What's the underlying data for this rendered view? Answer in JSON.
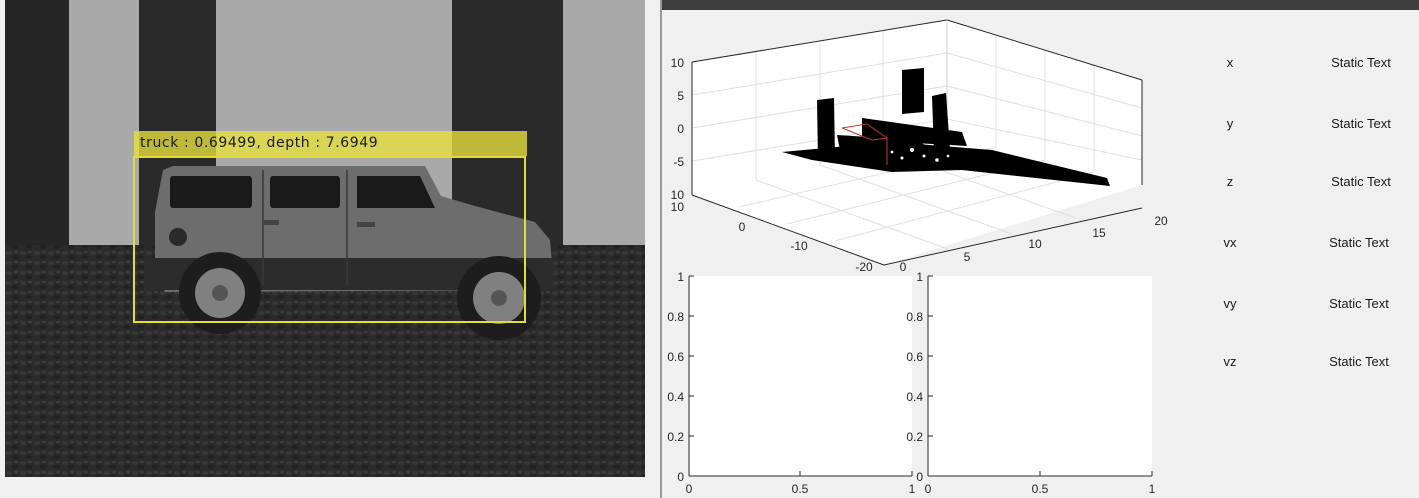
{
  "camera": {
    "detection_label": "truck : 0.69499, depth : 7.6949"
  },
  "plot3d": {
    "z_ticks": [
      "10",
      "5",
      "0",
      "-5",
      "10"
    ],
    "y_ticks": [
      "10",
      "0",
      "-10",
      "-20"
    ],
    "x_ticks": [
      "0",
      "5",
      "10",
      "15",
      "20"
    ]
  },
  "axes_left": {
    "y_ticks": [
      "1",
      "0.8",
      "0.6",
      "0.4",
      "0.2",
      "0"
    ],
    "x_ticks": [
      "0",
      "0.5",
      "1"
    ]
  },
  "axes_right": {
    "y_ticks": [
      "1",
      "0.8",
      "0.6",
      "0.4",
      "0.2",
      "0"
    ],
    "x_ticks": [
      "0",
      "0.5",
      "1"
    ]
  },
  "readouts": [
    {
      "label": "x",
      "value": "Static Text"
    },
    {
      "label": "y",
      "value": "Static Text"
    },
    {
      "label": "z",
      "value": "Static Text"
    },
    {
      "label": "vx",
      "value": "Static Text"
    },
    {
      "label": "vy",
      "value": "Static Text"
    },
    {
      "label": "vz",
      "value": "Static Text"
    }
  ],
  "colors": {
    "detection_box": "#e3dc3b",
    "trajectory": "#c0392b"
  }
}
